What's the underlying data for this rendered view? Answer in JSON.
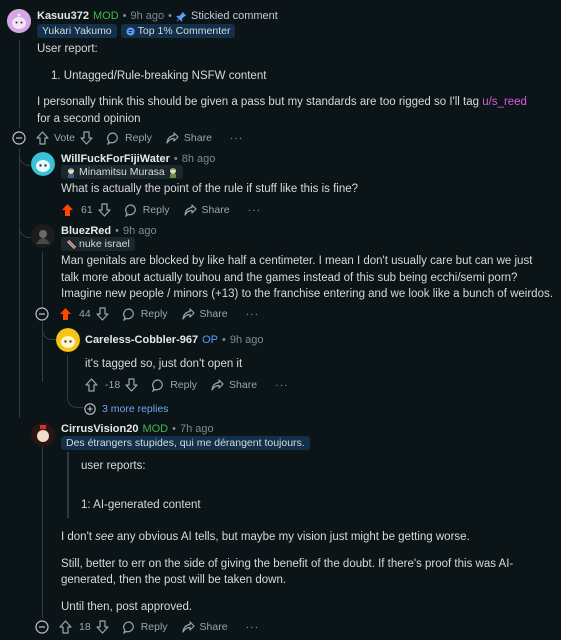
{
  "c1": {
    "author": "Kasuu372",
    "mod": "MOD",
    "time": "9h ago",
    "stickied": "Stickied comment",
    "flair": "Yukari Yakumo",
    "badge": "Top 1% Commenter",
    "p1": "User report:",
    "list_item": "1. Untagged/Rule-breaking NSFW content",
    "p2_before": "I personally think this should be given a pass but my standards are too rigged so I'll tag ",
    "p2_link": "u/s_reed",
    "p2_after": " for a second opinion",
    "vote": "Vote",
    "reply": "Reply",
    "share": "Share",
    "more": "···"
  },
  "c2": {
    "author": "WillFuckForFijiWater",
    "time": "8h ago",
    "flair": "Minamitsu Murasa",
    "text": "What is actually the point of the rule if stuff like this is fine?",
    "score": "61",
    "reply": "Reply",
    "share": "Share",
    "more": "···"
  },
  "c3": {
    "author": "BluezRed",
    "time": "9h ago",
    "flair": "nuke israel",
    "text": "Man genitals are blocked by like half a centimeter. I mean I don't usually care but can we just talk more about actually touhou and the games instead of this sub being ecchi/semi porn? Imagine new people / minors (+13) to the franchise entering and we look like a bunch of weirdos.",
    "score": "44",
    "reply": "Reply",
    "share": "Share",
    "more": "···"
  },
  "c4": {
    "author": "Careless-Cobbler-967",
    "op": "OP",
    "time": "9h ago",
    "text": "it's tagged so, just don't open it",
    "score": "-18",
    "reply": "Reply",
    "share": "Share",
    "more": "···"
  },
  "more_replies": "3 more replies",
  "c5": {
    "author": "CirrusVision20",
    "mod": "MOD",
    "time": "7h ago",
    "flair": "Des étrangers stupides, qui me dérangent toujours.",
    "q1": "user reports:",
    "q2": "1: AI-generated content",
    "p1_before": "I don't ",
    "p1_em": "see",
    "p1_after": " any obvious AI tells, but maybe my vision just might be getting worse.",
    "p2": "Still, better to err on the side of giving the benefit of the doubt. If there's proof this was AI-generated, then the post will be taken down.",
    "p3": "Until then, post approved.",
    "score": "18",
    "reply": "Reply",
    "share": "Share",
    "more": "···"
  },
  "colors": {
    "background": "#0b1416",
    "mod": "#3fb950",
    "upvote": "#ff4500",
    "link": "#d95bd9",
    "op": "#5a9cf8"
  }
}
